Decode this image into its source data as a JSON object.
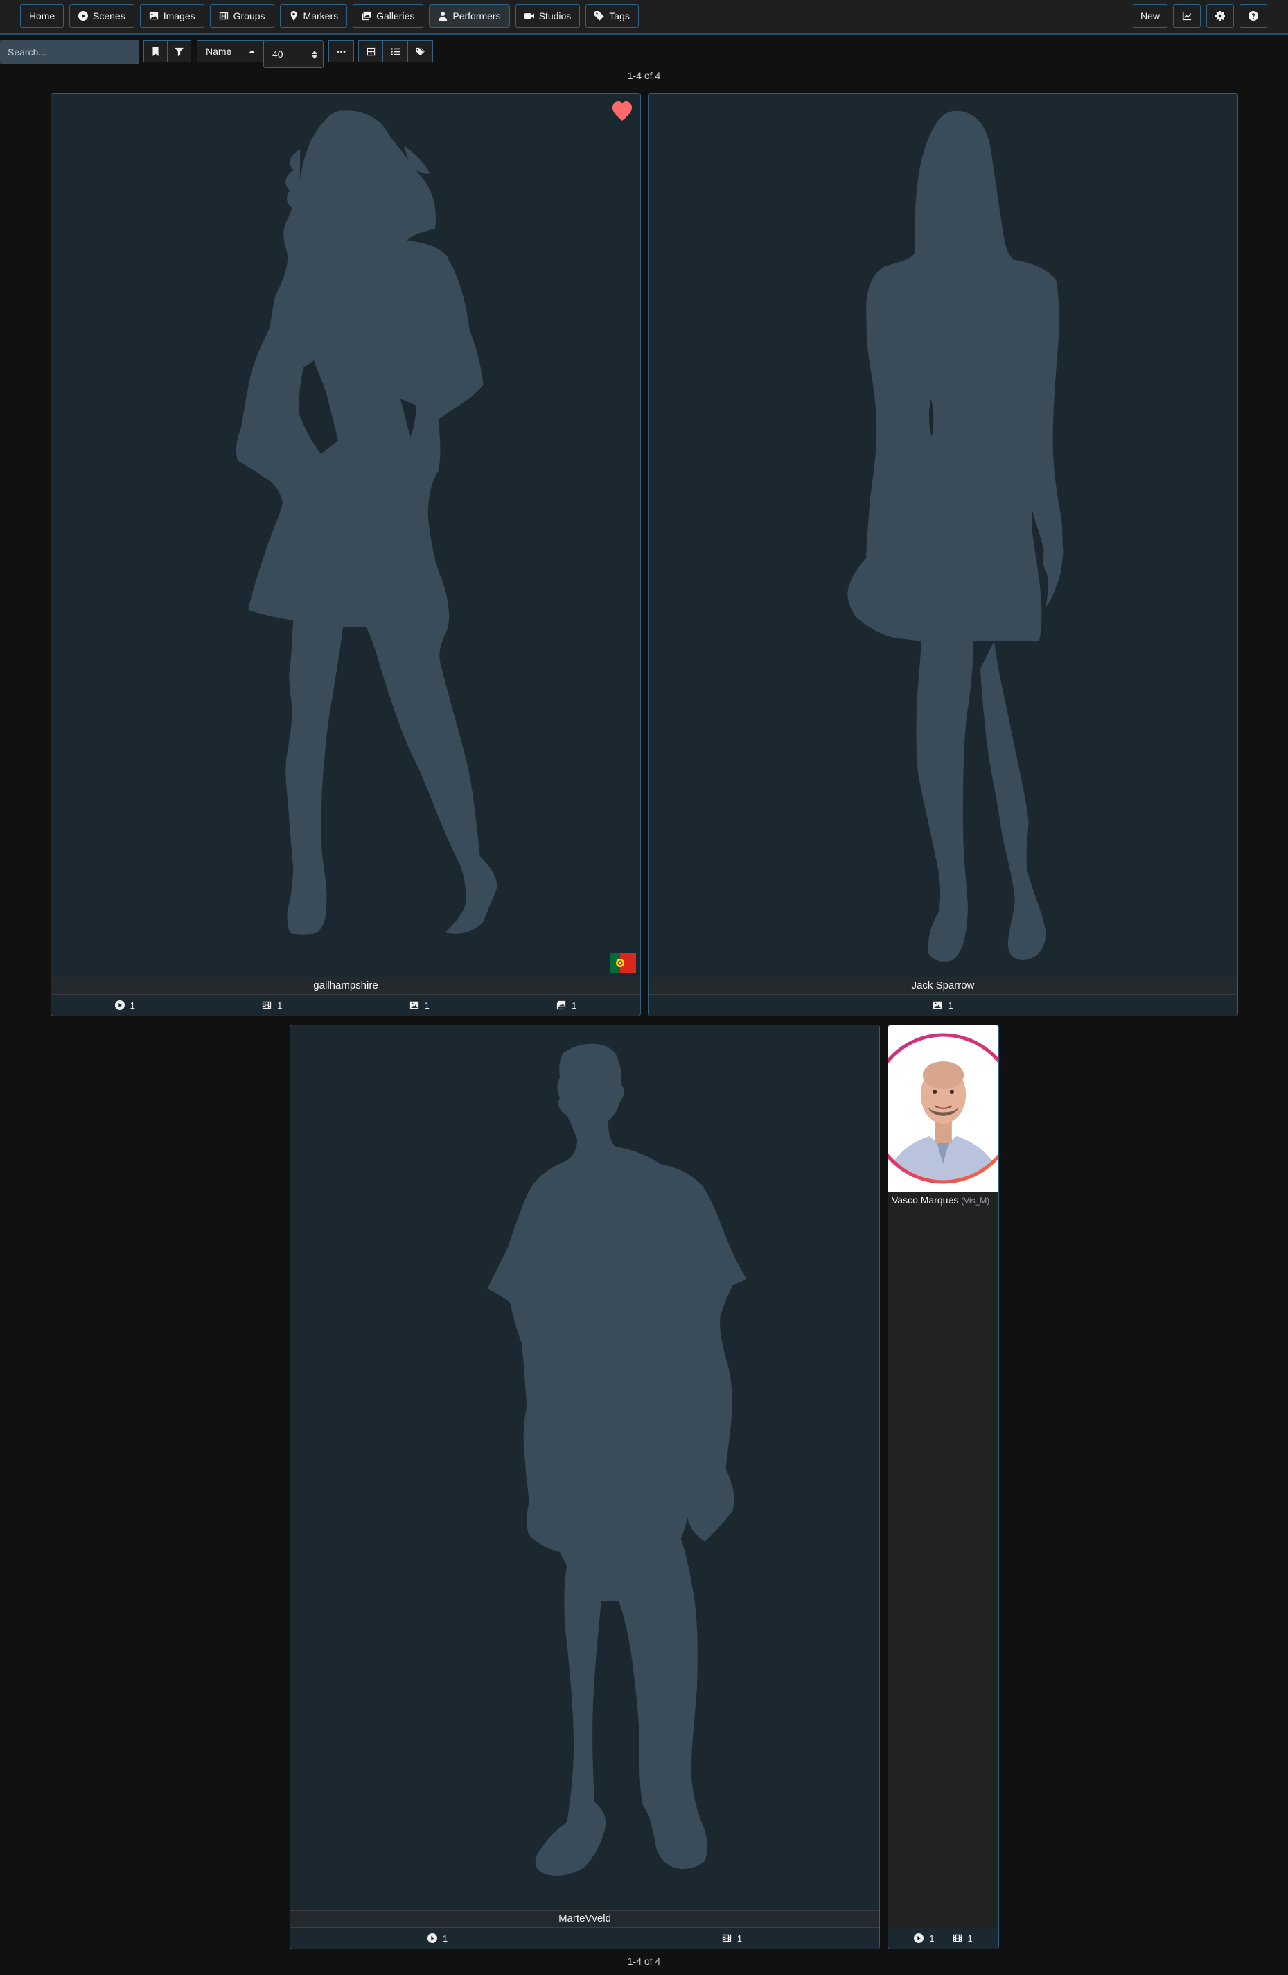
{
  "nav": {
    "items": [
      {
        "label": "Home"
      },
      {
        "label": "Scenes"
      },
      {
        "label": "Images"
      },
      {
        "label": "Groups"
      },
      {
        "label": "Markers"
      },
      {
        "label": "Galleries"
      },
      {
        "label": "Performers"
      },
      {
        "label": "Studios"
      },
      {
        "label": "Tags"
      }
    ],
    "active": "Performers",
    "new_label": "New"
  },
  "toolbar": {
    "search_placeholder": "Search...",
    "sort_by": "Name",
    "per_page": "40"
  },
  "pagination": {
    "top": "1-4 of 4",
    "bottom": "1-4 of 4"
  },
  "performers": [
    {
      "name": "gailhampshire",
      "favorite": true,
      "country_flag": "Portugal",
      "counts": {
        "scenes": "1",
        "groups": "1",
        "images": "1",
        "galleries": "1"
      }
    },
    {
      "name": "Jack Sparrow",
      "favorite": false,
      "counts": {
        "images": "1"
      }
    },
    {
      "name": "MarteVveld",
      "favorite": false,
      "counts": {
        "scenes": "1",
        "groups": "1"
      }
    },
    {
      "name": "Vasco Marques",
      "disambiguation": "(Vis_M)",
      "favorite": false,
      "counts": {
        "scenes": "1",
        "groups": "1"
      }
    }
  ],
  "colors": {
    "accent": "#2e6586",
    "card_bg": "#1c2830",
    "silhouette": "#3a4b5a",
    "favorite": "#ff6b6b"
  }
}
